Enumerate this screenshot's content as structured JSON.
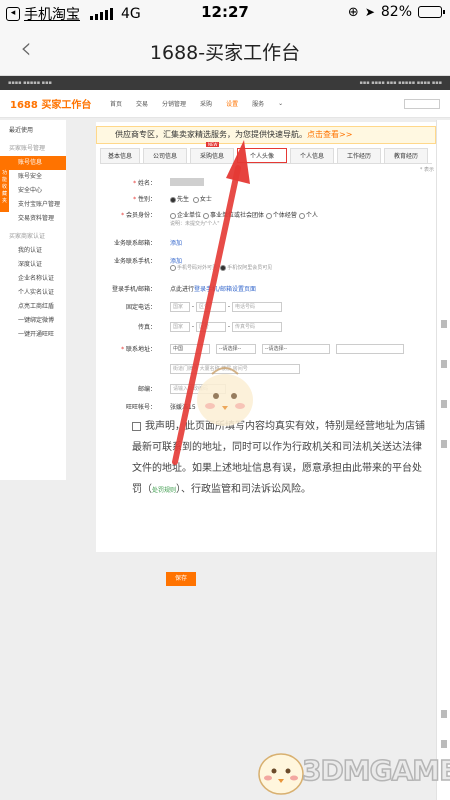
{
  "statusbar": {
    "app_back": "手机淘宝",
    "network": "4G",
    "time": "12:27",
    "battery_text": "82%",
    "battery_level": 0.82
  },
  "navbar": {
    "title": "1688-买家工作台"
  },
  "site": {
    "logo": "1688 买家工作台",
    "nav": [
      "首页",
      "交易",
      "分销管理",
      "采购",
      "设置",
      "服务"
    ],
    "active_nav": "设置"
  },
  "sidebar": {
    "fav_tab": "功能收藏夹",
    "recent": "最近使用",
    "groups": [
      {
        "title": "买家账号管理",
        "items": [
          "账号信息",
          "账号安全",
          "安全中心",
          "支付宝账户管理",
          "交易资料管理"
        ]
      },
      {
        "title": "买家商家认证",
        "items": [
          "我的认证",
          "深度认证",
          "企业名称认证",
          "个人实名认证",
          "点亮工商红盾",
          "一键绑定微博",
          "一键开通旺旺"
        ]
      }
    ],
    "active_item": "账号信息"
  },
  "content": {
    "banner_text": "供应商专区，汇集卖家精选服务，为您提供快速导航。",
    "banner_link": "点击查看>>",
    "tabs": [
      "基本信息",
      "公司信息",
      "采购信息",
      "个人头像",
      "个人信息",
      "工作经历",
      "教育经历"
    ],
    "highlighted_tab": "个人头像",
    "tab_badge": "NEW",
    "required_note": "* 表示",
    "form": {
      "name_label": "姓名：",
      "gender_label": "性别：",
      "gender_male": "先生",
      "gender_female": "女士",
      "identity_label": "会员身份：",
      "identity_options": [
        "企业单位",
        "事业单位或社会团体",
        "个体经营",
        "个人"
      ],
      "identity_hint": "说明：未提交为\"个人\"",
      "email_label": "业务联系邮箱：",
      "email_link": "添加",
      "mobile_label": "业务联系手机：",
      "mobile_link": "添加",
      "mobile_visibility": [
        "手机号码对外可见",
        "手机仅阿里会员可见"
      ],
      "login_phone_label": "登录手机/邮箱：",
      "login_phone_text": "点此进行",
      "login_phone_link": "登录手机/邮箱设置页面",
      "landline_label": "固定电话：",
      "landline_ph": [
        "国家",
        "区号",
        "电话号码"
      ],
      "fax_label": "传真：",
      "fax_ph": [
        "国家",
        "区号",
        "传真号码"
      ],
      "address_label": "联系地址：",
      "address_selects": [
        "中国",
        "--请选择--",
        "--请选择--",
        ""
      ],
      "street_ph": "街道门牌号 大厦名称 楼层 房间号",
      "zip_label": "邮编：",
      "zip_ph": "请输入邮政编码",
      "wangwang_label": "旺旺帐号：",
      "wangwang_value": "张媛浩15"
    },
    "declaration": "我声明，此页面所填写内容均真实有效，特别是经营地址为店铺最新可联系到的地址，同时可以作为行政机关和司法机关送达法律文件的地址。如果上述地址信息有误，愿意承担由此带来的平台处罚（",
    "declaration_small": "处罚规则",
    "declaration_end": "）、行政监管和司法诉讼风险。",
    "save_button": "保存"
  },
  "watermark": "3DMGAME",
  "colors": {
    "accent": "#ff7300",
    "highlight_red": "#e53935",
    "link_blue": "#3366cc"
  }
}
